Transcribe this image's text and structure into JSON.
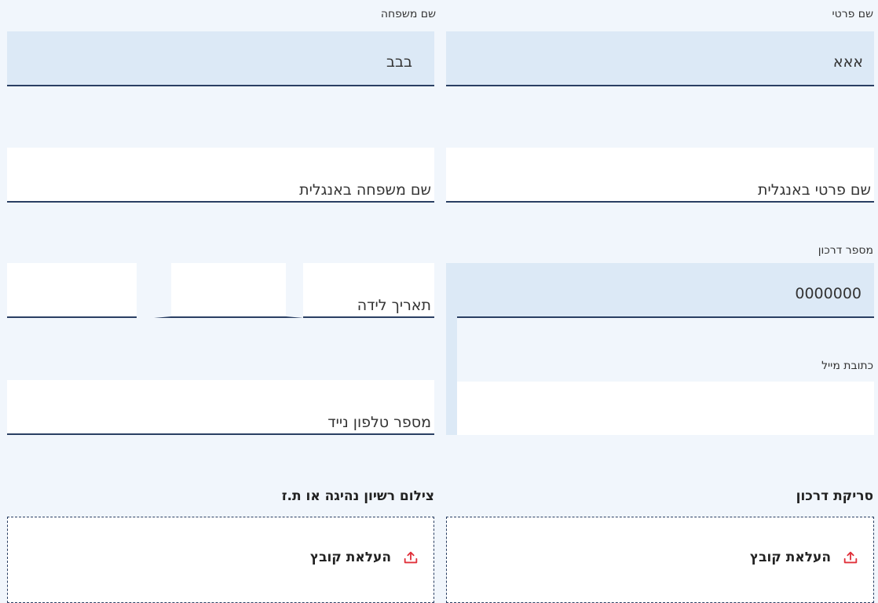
{
  "form": {
    "first_name": {
      "label": "שם פרטי",
      "value": "אאא"
    },
    "last_name": {
      "label": "שם משפחה",
      "value": "בבב"
    },
    "first_name_english": {
      "placeholder": "שם פרטי באנגלית"
    },
    "last_name_english": {
      "placeholder": "שם משפחה באנגלית"
    },
    "passport_number": {
      "label": "מספר דרכון",
      "value": "0000000"
    },
    "birth_date": {
      "placeholder": "תאריך לידה"
    },
    "email": {
      "label": "כתובת מייל"
    },
    "mobile_phone": {
      "placeholder": "מספר טלפון נייד"
    }
  },
  "uploads": {
    "passport_scan": {
      "title": "סריקת דרכון",
      "button_label": "העלאת קובץ"
    },
    "license_photo": {
      "title": "צילום רשיון נהיגה או ת.ז",
      "button_label": "העלאת קובץ"
    }
  },
  "colors": {
    "page_background": "#f1f6fc",
    "filled_field_background": "#dce9f6",
    "field_underline": "#2a3f63",
    "upload_icon": "#e0303a"
  },
  "icons": {
    "upload": "upload-icon"
  }
}
